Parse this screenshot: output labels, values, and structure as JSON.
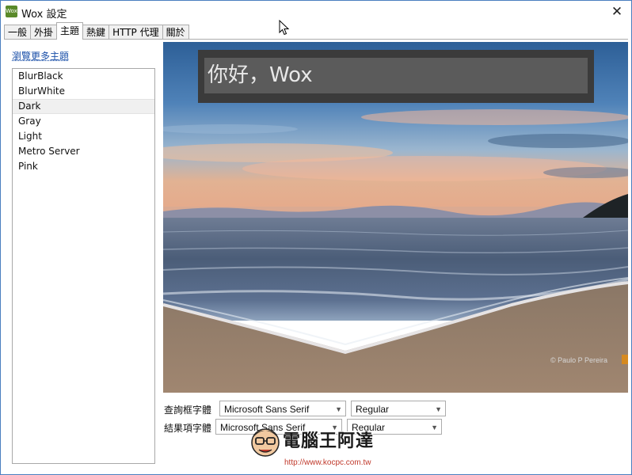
{
  "window": {
    "icon_text": "Wox",
    "title": "Wox 設定",
    "close_symbol": "✕"
  },
  "tabs": [
    {
      "label": "一般",
      "active": false
    },
    {
      "label": "外掛",
      "active": false
    },
    {
      "label": "主題",
      "active": true
    },
    {
      "label": "熱鍵",
      "active": false
    },
    {
      "label": "HTTP 代理",
      "active": false
    },
    {
      "label": "關於",
      "active": false
    }
  ],
  "theme_panel": {
    "browse_link": "瀏覽更多主題",
    "themes": [
      "BlurBlack",
      "BlurWhite",
      "Dark",
      "Gray",
      "Light",
      "Metro Server",
      "Pink"
    ],
    "selected_theme": "Dark"
  },
  "preview": {
    "query_text": "你好，Wox",
    "photo_credit": "© Paulo P Pereira"
  },
  "font_settings": {
    "query_font_label": "查詢框字體",
    "query_font_family": "Microsoft Sans Serif",
    "query_font_style": "Regular",
    "result_font_label": "結果項字體",
    "result_font_family": "Microsoft Sans Serif",
    "result_font_style": "Regular"
  },
  "watermark": {
    "title": "電腦王阿達",
    "url": "http://www.kocpc.com.tw"
  }
}
